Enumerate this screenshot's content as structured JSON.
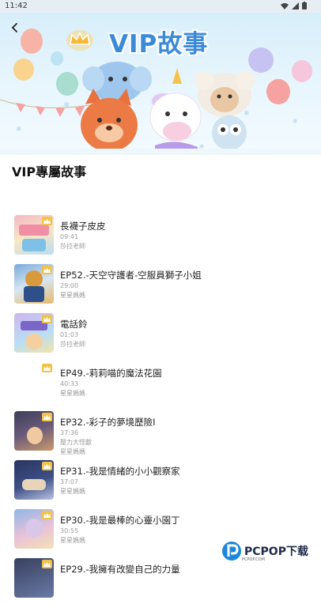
{
  "status": {
    "time": "11:42"
  },
  "banner": {
    "title": "VIP故事"
  },
  "section": {
    "title": "VIP專屬故事"
  },
  "colors": {
    "crown": "#f4c24a",
    "vip_blue": "#3a8ad8"
  },
  "items": [
    {
      "title": "長襪子皮皮",
      "duration": "09:41",
      "author": "莎拉老師"
    },
    {
      "title": "EP52.-天空守護者-空服員獅子小姐",
      "duration": "29:00",
      "author": "星星媽媽"
    },
    {
      "title": "電話鈴",
      "duration": "01:03",
      "author": "莎拉老師"
    },
    {
      "title": "EP49.-莉莉喵的魔法花園",
      "duration": "40:33",
      "author": "星星媽媽"
    },
    {
      "title": "EP32.-彩子的夢境歷險I",
      "duration": "37:36",
      "extra": "壓力大怪獸",
      "author": "星星媽媽"
    },
    {
      "title": "EP31.-我是情緒的小小觀察家",
      "duration": "37:07",
      "author": "星星媽媽"
    },
    {
      "title": "EP30.-我是最棒的心靈小園丁",
      "duration": "30:55",
      "author": "星星媽媽"
    },
    {
      "title": "EP29.-我擁有改變自己的力量"
    }
  ],
  "watermark": {
    "brand": "PCPOP下载",
    "sub": "PCPOP.COM"
  }
}
